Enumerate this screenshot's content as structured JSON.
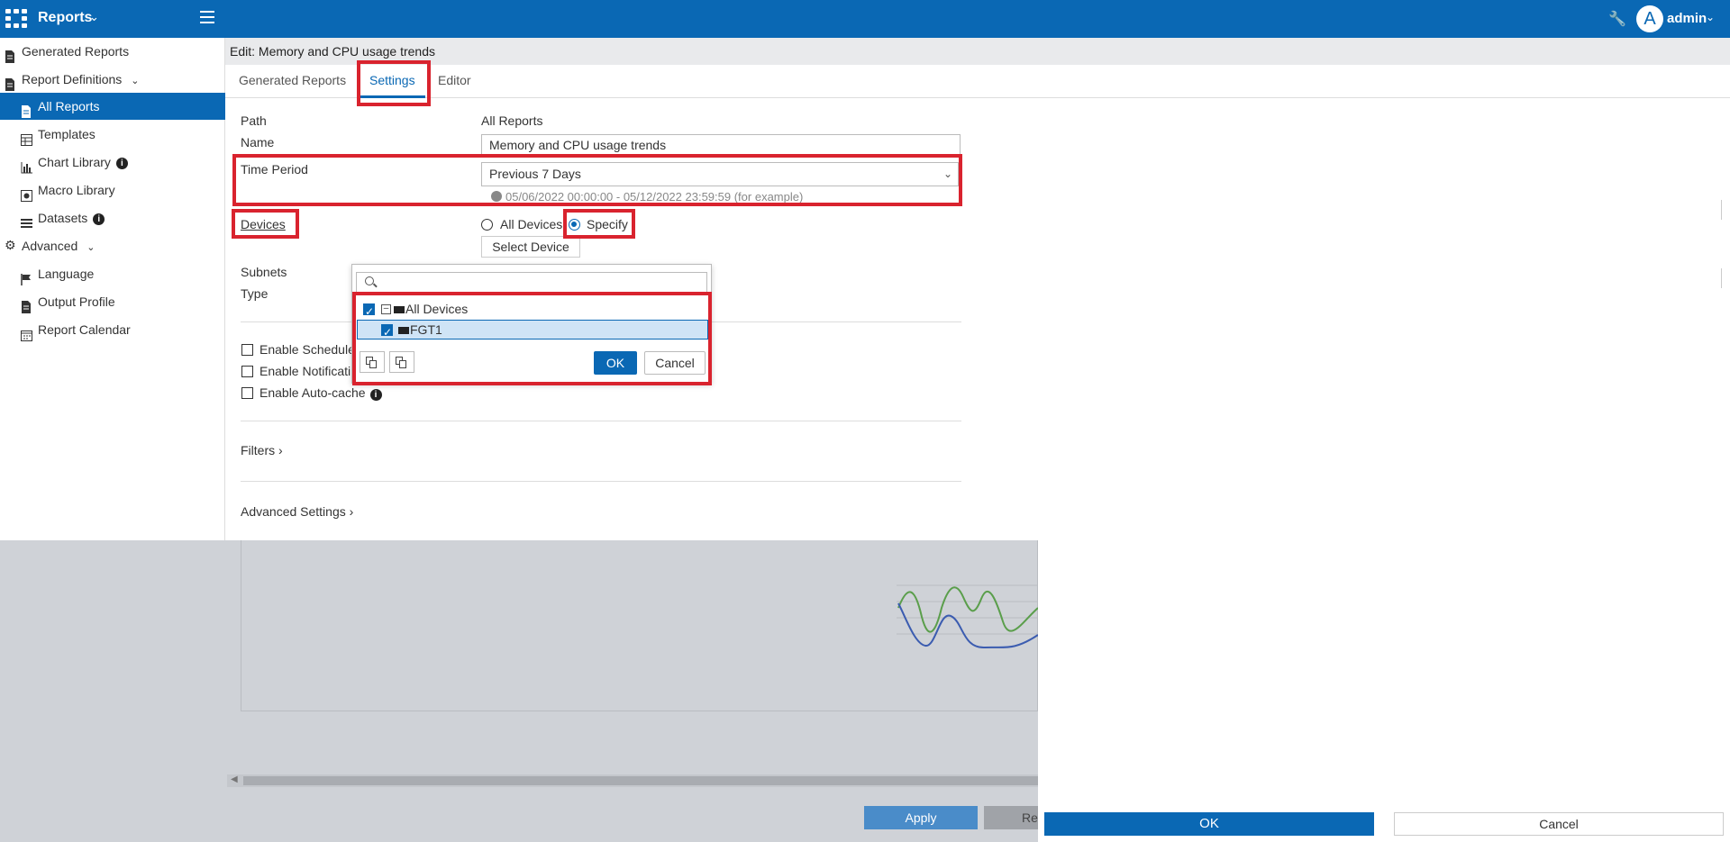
{
  "topbar": {
    "app_title": "Reports",
    "user": "admin",
    "avatar_letter": "A"
  },
  "sidebar": {
    "items": [
      {
        "label": "Generated Reports"
      },
      {
        "label": "Report Definitions"
      },
      {
        "label": "All Reports"
      },
      {
        "label": "Templates"
      },
      {
        "label": "Chart Library"
      },
      {
        "label": "Macro Library"
      },
      {
        "label": "Datasets"
      },
      {
        "label": "Advanced"
      },
      {
        "label": "Language"
      },
      {
        "label": "Output Profile"
      },
      {
        "label": "Report Calendar"
      }
    ]
  },
  "main": {
    "title": "Edit: Memory and CPU usage trends",
    "tabs": [
      {
        "label": "Generated Reports"
      },
      {
        "label": "Settings"
      },
      {
        "label": "Editor"
      }
    ]
  },
  "form": {
    "path_label": "Path",
    "path_value": "All Reports",
    "name_label": "Name",
    "name_value": "Memory and CPU usage trends",
    "time_period_label": "Time Period",
    "time_period_value": "Previous 7 Days",
    "time_hint": "05/06/2022 00:00:00 - 05/12/2022 23:59:59 (for example)",
    "devices_label": "Devices",
    "all_devices_option": "All Devices",
    "specify_option": "Specify",
    "select_device_button": "Select Device",
    "subnets_label": "Subnets",
    "type_label": "Type",
    "enable_schedule": "Enable Schedule",
    "enable_notification": "Enable Notificati",
    "enable_autocache": "Enable Auto-cache",
    "filters_label": "Filters",
    "advanced_settings_label": "Advanced Settings"
  },
  "popup": {
    "search_placeholder": "",
    "tree": [
      {
        "label": "All Devices",
        "checked": true
      },
      {
        "label": "FGT1",
        "checked": true
      }
    ],
    "ok_label": "OK",
    "cancel_label": "Cancel"
  },
  "footer": {
    "apply_label": "Apply",
    "reset_label": "Re",
    "ok_label": "OK",
    "cancel_label": "Cancel"
  },
  "chart_preview": {
    "line_colors": [
      "#5a9e4b",
      "#3b5cb0"
    ]
  },
  "colors": {
    "brand": "#0a68b4",
    "highlight": "#d9232e"
  }
}
